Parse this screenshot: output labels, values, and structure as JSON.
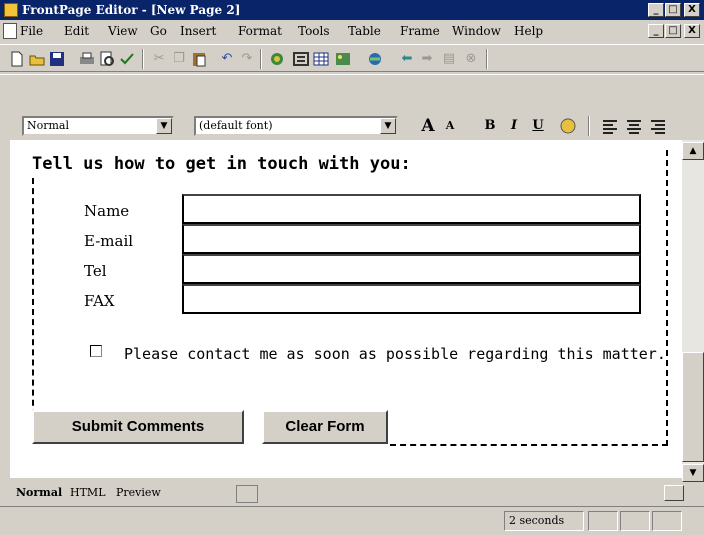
{
  "window": {
    "title": "FrontPage Editor - [New Page 2]",
    "controls": [
      "_",
      "□",
      "X"
    ]
  },
  "menu": {
    "items": [
      "File",
      "Edit",
      "View",
      "Go",
      "Insert",
      "Format",
      "Tools",
      "Table",
      "Frame",
      "Window",
      "Help"
    ],
    "mdi_controls": [
      "_",
      "□",
      "X"
    ]
  },
  "toolbar": {
    "icons": [
      "new-icon",
      "open-icon",
      "save-icon",
      "print-icon",
      "print-preview-icon",
      "spelling-icon",
      "cut-icon",
      "copy-icon",
      "paste-icon",
      "undo-icon",
      "redo-icon",
      "webbot-icon",
      "form-field-icon",
      "table-icon",
      "image-icon",
      "hyperlink-icon",
      "back-icon",
      "forward-icon",
      "refresh-icon",
      "stop-icon"
    ]
  },
  "format_bar": {
    "style_value": "Normal",
    "font_value": "(default font)",
    "buttons": [
      "A",
      "A",
      "B",
      "I",
      "U"
    ]
  },
  "form": {
    "heading": "Tell us how to get in touch with you:",
    "fields": [
      {
        "label": "Name",
        "value": ""
      },
      {
        "label": "E-mail",
        "value": ""
      },
      {
        "label": "Tel",
        "value": ""
      },
      {
        "label": "FAX",
        "value": ""
      }
    ],
    "contact_checkbox_label": "Please contact me as soon as possible regarding this matter.",
    "submit_label": "Submit Comments",
    "clear_label": "Clear Form"
  },
  "tabs": {
    "items": [
      "Normal",
      "HTML",
      "Preview"
    ],
    "active": "Normal"
  },
  "status": {
    "time": "2 seconds"
  }
}
